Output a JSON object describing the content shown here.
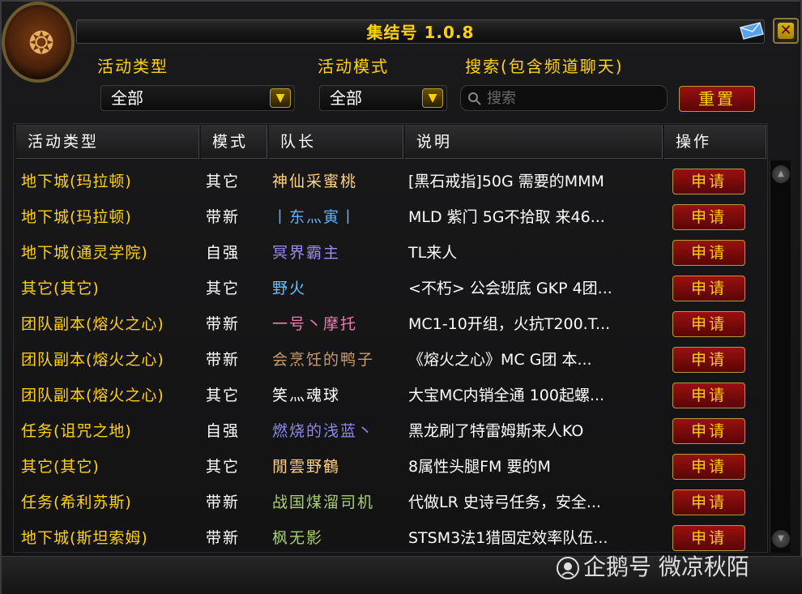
{
  "window": {
    "title": "集结号 1.0.8"
  },
  "filters": {
    "type_label": "活动类型",
    "type_value": "全部",
    "mode_label": "活动模式",
    "mode_value": "全部",
    "search_label": "搜索(包含频道聊天)",
    "search_placeholder": "搜索",
    "reset_label": "重置"
  },
  "table": {
    "headers": {
      "type": "活动类型",
      "mode": "模式",
      "leader": "队长",
      "desc": "说明",
      "action": "操作"
    },
    "rows": [
      {
        "type": "地下城(玛拉顿)",
        "mode": "其它",
        "leader": "神仙采蜜桃",
        "leader_color": "#ffd27f",
        "desc": "[黑石戒指]50G 需要的MMM",
        "action": "申请"
      },
      {
        "type": "地下城(玛拉顿)",
        "mode": "带新",
        "leader": "丨东灬寅丨",
        "leader_color": "#5fb3ff",
        "desc": "MLD 紫门 5G不拾取 来46...",
        "action": "申请"
      },
      {
        "type": "地下城(通灵学院)",
        "mode": "自强",
        "leader": "冥界霸主",
        "leader_color": "#9d8df0",
        "desc": "TL来人",
        "action": "申请"
      },
      {
        "type": "其它(其它)",
        "mode": "其它",
        "leader": "野火",
        "leader_color": "#5fc8ff",
        "desc": "<不朽> 公会班底 GKP 4团...",
        "action": "申请"
      },
      {
        "type": "团队副本(熔火之心)",
        "mode": "带新",
        "leader": "一号丶摩托",
        "leader_color": "#f07ab4",
        "desc": "MC1-10开组，火抗T200.T...",
        "action": "申请"
      },
      {
        "type": "团队副本(熔火之心)",
        "mode": "带新",
        "leader": "会烹饪的鸭子",
        "leader_color": "#c79c6e",
        "desc": "《熔火之心》MC G团 本...",
        "action": "申请"
      },
      {
        "type": "团队副本(熔火之心)",
        "mode": "其它",
        "leader": "笑灬魂球",
        "leader_color": "#ffffff",
        "desc": "大宝MC内销全通 100起螺...",
        "action": "申请"
      },
      {
        "type": "任务(诅咒之地)",
        "mode": "自强",
        "leader": "燃烧的浅蓝丶",
        "leader_color": "#8f88e8",
        "desc": "黑龙刷了特雷姆斯来人KO",
        "action": "申请"
      },
      {
        "type": "其它(其它)",
        "mode": "其它",
        "leader": "閒雲野鶴",
        "leader_color": "#ffd27f",
        "desc": "8属性头腿FM 要的M",
        "action": "申请"
      },
      {
        "type": "任务(希利苏斯)",
        "mode": "带新",
        "leader": "战国煤溜司机",
        "leader_color": "#a8d06a",
        "desc": "代做LR 史诗弓任务，安全...",
        "action": "申请"
      },
      {
        "type": "地下城(斯坦索姆)",
        "mode": "带新",
        "leader": "枫无影",
        "leader_color": "#a8d06a",
        "desc": "STSM3法1猎固定效率队伍...",
        "action": "申请"
      }
    ]
  },
  "watermark": {
    "text": "企鹅号 微凉秋陌"
  },
  "icons": {
    "portrait": "dragon-portrait-icon",
    "mail": "mail-icon",
    "close": "close-icon",
    "dropdown": "chevron-down-icon",
    "search": "search-icon",
    "scroll_up": "scroll-up-icon",
    "scroll_down": "scroll-down-icon"
  },
  "colors": {
    "gold": "#ffd200",
    "button_red": "#9a1010",
    "text_white": "#ffffff"
  }
}
